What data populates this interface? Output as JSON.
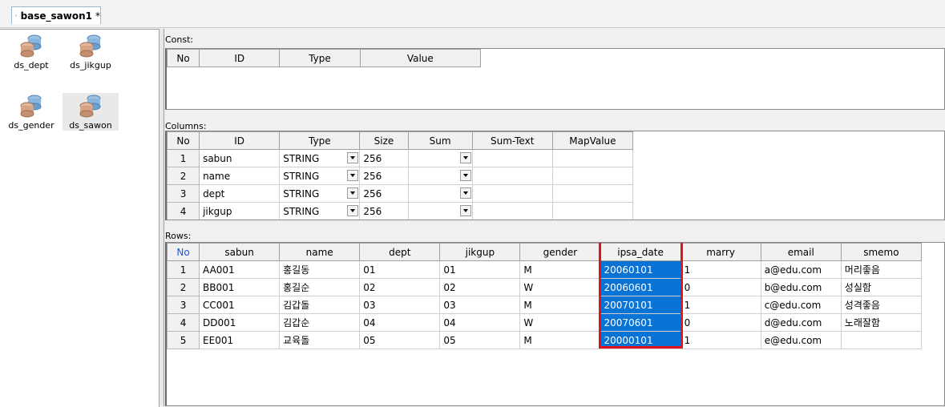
{
  "tab": {
    "title": "base_sawon1",
    "modified_marker": "*"
  },
  "datasets": [
    {
      "label": "ds_dept"
    },
    {
      "label": "ds_jikgup"
    },
    {
      "label": "ds_gender"
    },
    {
      "label": "ds_sawon"
    }
  ],
  "const_section": {
    "label": "Const:",
    "headers": [
      "No",
      "ID",
      "Type",
      "Value"
    ]
  },
  "columns_section": {
    "label": "Columns:",
    "headers": [
      "No",
      "ID",
      "Type",
      "Size",
      "Sum",
      "Sum-Text",
      "MapValue"
    ],
    "rows": [
      {
        "no": "1",
        "id": "sabun",
        "type": "STRING",
        "size": "256",
        "sum": "",
        "sumtext": "",
        "mapvalue": ""
      },
      {
        "no": "2",
        "id": "name",
        "type": "STRING",
        "size": "256",
        "sum": "",
        "sumtext": "",
        "mapvalue": ""
      },
      {
        "no": "3",
        "id": "dept",
        "type": "STRING",
        "size": "256",
        "sum": "",
        "sumtext": "",
        "mapvalue": ""
      },
      {
        "no": "4",
        "id": "jikgup",
        "type": "STRING",
        "size": "256",
        "sum": "",
        "sumtext": "",
        "mapvalue": ""
      }
    ]
  },
  "rows_section": {
    "label": "Rows:",
    "headers": [
      "No",
      "sabun",
      "name",
      "dept",
      "jikgup",
      "gender",
      "ipsa_date",
      "marry",
      "email",
      "smemo"
    ],
    "rows": [
      {
        "no": "1",
        "sabun": "AA001",
        "name": "홍길동",
        "dept": "01",
        "jikgup": "01",
        "gender": "M",
        "ipsa_date": "20060101",
        "marry": "1",
        "email": "a@edu.com",
        "smemo": "머리좋음"
      },
      {
        "no": "2",
        "sabun": "BB001",
        "name": "홍길순",
        "dept": "02",
        "jikgup": "02",
        "gender": "W",
        "ipsa_date": "20060601",
        "marry": "0",
        "email": "b@edu.com",
        "smemo": "성실함"
      },
      {
        "no": "3",
        "sabun": "CC001",
        "name": "김갑돌",
        "dept": "03",
        "jikgup": "03",
        "gender": "M",
        "ipsa_date": "20070101",
        "marry": "1",
        "email": "c@edu.com",
        "smemo": "성격좋음"
      },
      {
        "no": "4",
        "sabun": "DD001",
        "name": "김갑순",
        "dept": "04",
        "jikgup": "04",
        "gender": "W",
        "ipsa_date": "20070601",
        "marry": "0",
        "email": "d@edu.com",
        "smemo": "노래잘함"
      },
      {
        "no": "5",
        "sabun": "EE001",
        "name": "교육돌",
        "dept": "05",
        "jikgup": "05",
        "gender": "M",
        "ipsa_date": "20000101",
        "marry": "1",
        "email": "e@edu.com",
        "smemo": ""
      }
    ]
  },
  "colors": {
    "selection": "#0a74d6",
    "highlight_box": "#e0141a",
    "header_bg": "#f1f1f1"
  }
}
